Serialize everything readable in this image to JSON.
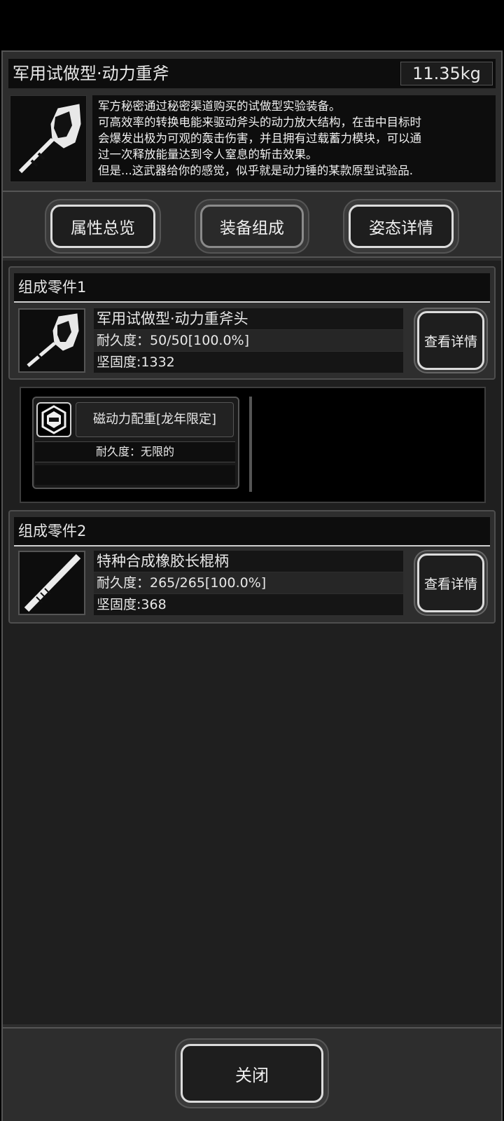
{
  "item": {
    "name": "军用试做型·动力重斧",
    "weight": "11.35kg",
    "description": [
      "军方秘密通过秘密渠道购买的试做型实验装备。",
      "可高效率的转换电能来驱动斧头的动力放大结构，在击中目标时",
      "会爆发出极为可观的轰击伤害，并且拥有过载蓄力模块，可以通",
      "过一次释放能量达到令人窒息的斩击效果。",
      "但是...这武器给你的感觉，似乎就是动力锤的某款原型试验品."
    ],
    "icon": "axe-icon"
  },
  "tabs": [
    {
      "label": "属性总览"
    },
    {
      "label": "装备组成"
    },
    {
      "label": "姿态详情"
    }
  ],
  "parts": [
    {
      "header": "组成零件1",
      "name": "军用试做型·动力重斧头",
      "durability": "耐久度：50/50[100.0%]",
      "hardness": "坚固度:1332",
      "detail_button": "查看详情",
      "icon": "axe-head-icon"
    },
    {
      "header": "组成零件2",
      "name": "特种合成橡胶长棍柄",
      "durability": "耐久度：265/265[100.0%]",
      "hardness": "坚固度:368",
      "detail_button": "查看详情",
      "icon": "staff-handle-icon"
    }
  ],
  "module": {
    "name": "磁动力配重[龙年限定]",
    "durability": "耐久度：无限的",
    "icon": "hexagon-module-icon"
  },
  "footer": {
    "close_label": "关闭"
  }
}
